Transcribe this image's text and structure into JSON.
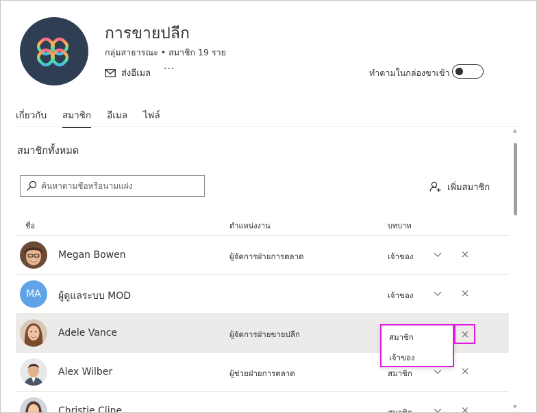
{
  "group": {
    "title": "การขายปลีก",
    "subtitle": "กลุ่มสาธารณะ • สมาชิก 19 ราย",
    "email_label": "ส่งอีเมล",
    "more_label": "···",
    "follow_label": "ทำตามในกล่องขาเข้า",
    "follow_enabled": false
  },
  "tabs": [
    {
      "label": "เกี่ยวกับ",
      "active": false
    },
    {
      "label": "สมาชิก",
      "active": true
    },
    {
      "label": "อีเมล",
      "active": false
    },
    {
      "label": "ไฟล์",
      "active": false
    }
  ],
  "members_section": {
    "title": "สมาชิกทั้งหมด",
    "search_placeholder": "ค้นหาตามชื่อหรือนามแฝง",
    "add_member_label": "เพิ่มสมาชิก"
  },
  "table": {
    "columns": {
      "name": "ชื่อ",
      "job_title": "ตำแหน่งงาน",
      "role": "บทบาท"
    },
    "rows": [
      {
        "name": "Megan Bowen",
        "job_title": "ผู้จัดการฝ่ายการตลาด",
        "role": "เจ้าของ",
        "avatar": "photo"
      },
      {
        "name": "ผู้ดูแลระบบ MOD",
        "job_title": "",
        "role": "เจ้าของ",
        "avatar": "MA"
      },
      {
        "name": "Adele Vance",
        "job_title": "ผู้จัดการฝ่ายขายปลีก",
        "role": "",
        "avatar": "photo",
        "selected": true
      },
      {
        "name": "Alex Wilber",
        "job_title": "ผู้ช่วยฝ่ายการตลาด",
        "role": "สมาชิก",
        "avatar": "photo"
      },
      {
        "name": "Christie Cline",
        "job_title": "",
        "role": "สมาชิก",
        "avatar": "photo"
      }
    ]
  },
  "role_dropdown": {
    "options": [
      "สมาชิก",
      "เจ้าของ"
    ],
    "highlight_color": "#e01ce0"
  },
  "colors": {
    "logo_bg": "#2f3e52",
    "initials_avatar": "#5fa4e6",
    "selected_row": "#edebe9"
  }
}
